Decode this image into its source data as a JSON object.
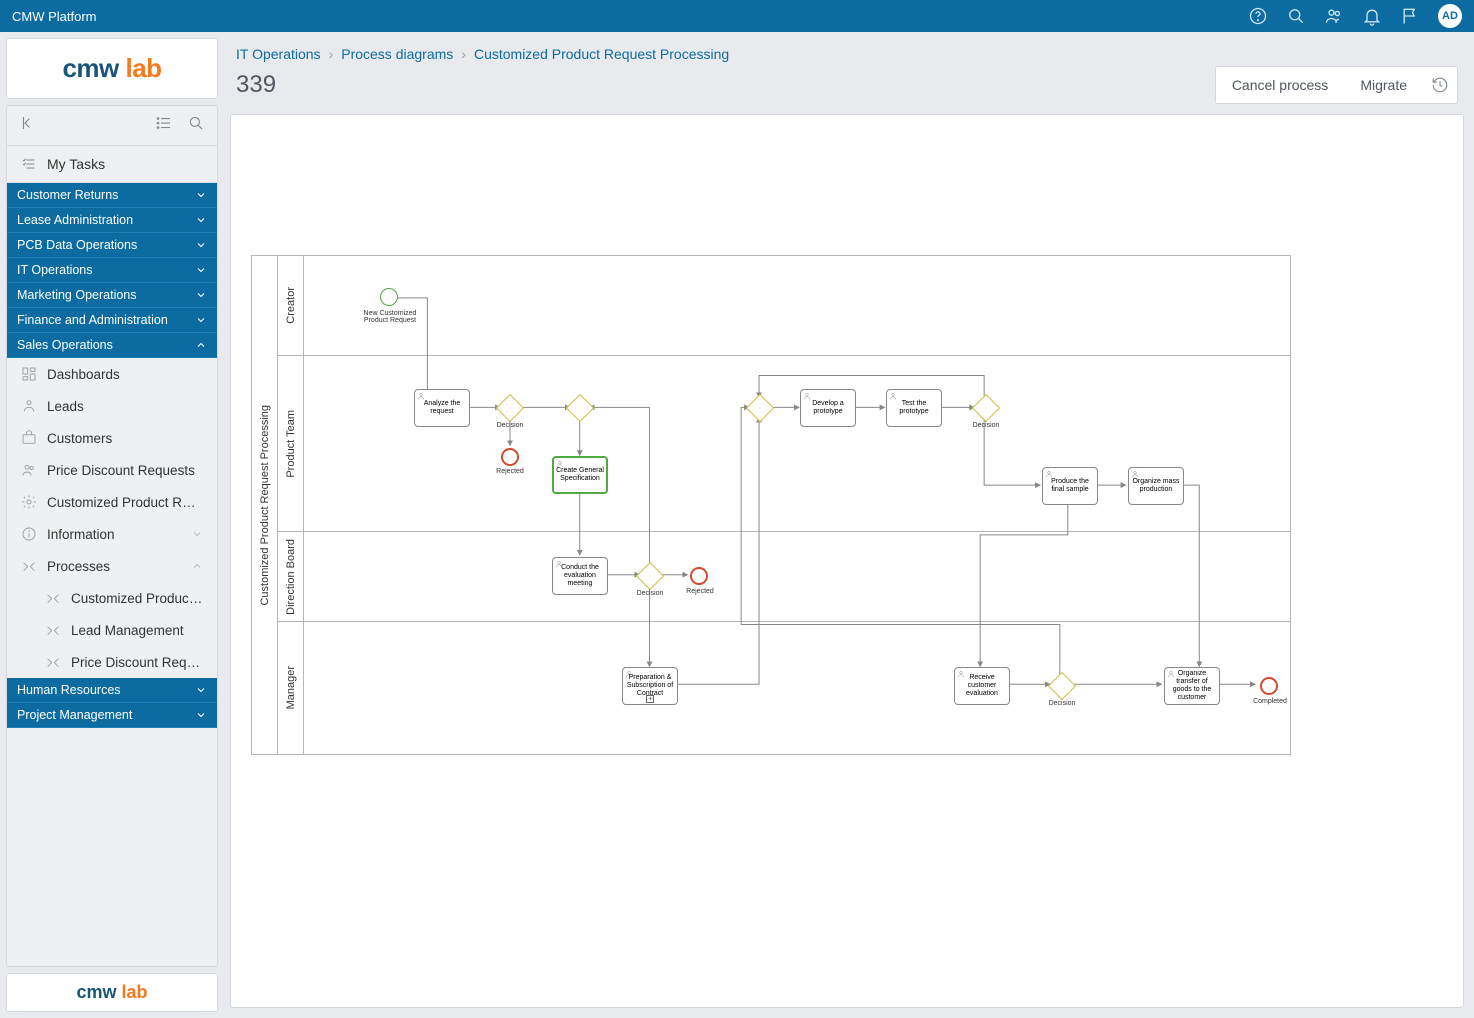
{
  "topbar": {
    "title": "CMW Platform",
    "avatar": "AD"
  },
  "logo": {
    "part1": "cmw",
    "part2": "lab"
  },
  "sidenav": {
    "my_tasks": "My Tasks",
    "groups": [
      {
        "label": "Customer Returns"
      },
      {
        "label": "Lease Administration"
      },
      {
        "label": "PCB Data Operations"
      },
      {
        "label": "IT Operations"
      },
      {
        "label": "Marketing Operations"
      },
      {
        "label": "Finance and Administration"
      },
      {
        "label": "Sales Operations",
        "expanded": true
      }
    ],
    "sales_items": [
      {
        "label": "Dashboards",
        "icon": "dash"
      },
      {
        "label": "Leads",
        "icon": "leads"
      },
      {
        "label": "Customers",
        "icon": "customers"
      },
      {
        "label": "Price Discount Requests",
        "icon": "discount"
      },
      {
        "label": "Customized Product Reque…",
        "icon": "gear"
      },
      {
        "label": "Information",
        "icon": "info",
        "chev": "down"
      },
      {
        "label": "Processes",
        "icon": "process",
        "chev": "up"
      }
    ],
    "process_subs": [
      {
        "label": "Customized Product R…"
      },
      {
        "label": "Lead Management"
      },
      {
        "label": "Price Discount Reques…"
      }
    ],
    "tail_groups": [
      {
        "label": "Human Resources"
      },
      {
        "label": "Project Management"
      }
    ]
  },
  "breadcrumbs": [
    "IT Operations",
    "Process diagrams",
    "Customized Product Request Processing"
  ],
  "page_id": "339",
  "actions": {
    "cancel": "Cancel process",
    "migrate": "Migrate"
  },
  "diagram": {
    "pool": "Customized Product Request Processing",
    "lanes": [
      "Creator",
      "Product Team",
      "Direction Board",
      "Manager"
    ],
    "tasks": {
      "new_req": "New Customized Product Request",
      "analyze": "Analyze the request",
      "create_spec": "Create General Specification",
      "conduct_eval": "Conduct the evaluation meeting",
      "prep_contract": "Preparation & Subscription of Contract",
      "develop_proto": "Develop a prototype",
      "test_proto": "Test the prototype",
      "produce_sample": "Produce the final sample",
      "organize_mass": "Organize mass production",
      "receive_eval": "Receive customer evaluation",
      "organize_transfer": "Organize transfer of goods to the customer"
    },
    "labels": {
      "decision": "Decision",
      "rejected": "Rejected",
      "completed": "Completed"
    }
  }
}
